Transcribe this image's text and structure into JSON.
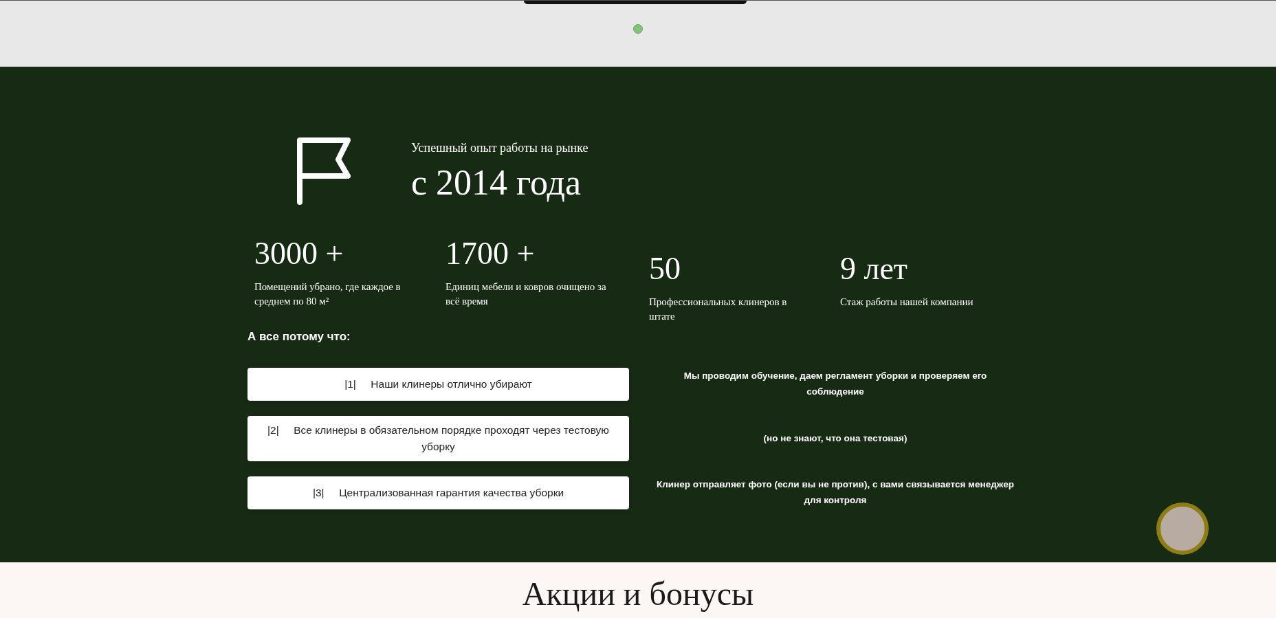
{
  "hero": {
    "subtitle": "Успешный опыт работы на рынке",
    "title": "с 2014 года"
  },
  "stats": [
    {
      "value": "3000 +",
      "caption": "Помещений убрано, где каждое в среднем по 80 м²"
    },
    {
      "value": "1700 +",
      "caption": "Единиц мебели и ковров очищено за всё время"
    },
    {
      "value": "50",
      "caption": "Профессиональных клинеров в штате"
    },
    {
      "value": "9 лет",
      "caption": "Стаж работы нашей компании"
    }
  ],
  "reasons_heading": "А все потому что:",
  "reasons": [
    {
      "number": "|1|",
      "text": "Наши клинеры отлично убирают",
      "note": "Мы проводим обучение, даем регламент уборки и проверяем его соблюдение"
    },
    {
      "number": "|2|",
      "text": "Все клинеры в обязательном порядке проходят через тестовую уборку",
      "note": "(но не знают, что она тестовая)"
    },
    {
      "number": "|3|",
      "text": "Централизованная гарантия качества уборки",
      "note": "Клинер отправляет фото (если вы не против), с вами связывается менеджер для контроля"
    }
  ],
  "next_section": {
    "title": "Акции и бонусы"
  }
}
